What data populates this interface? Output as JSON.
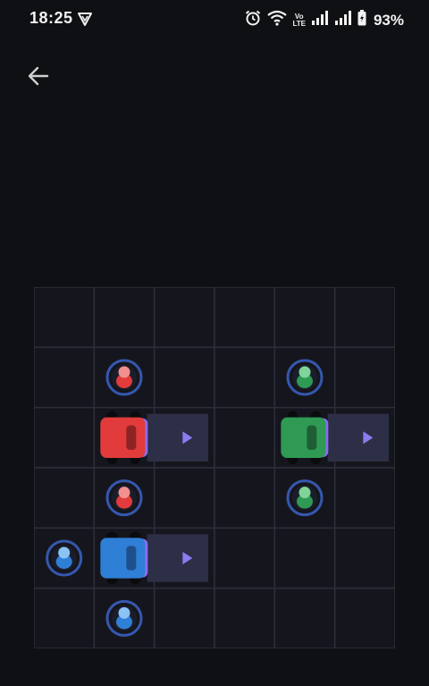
{
  "status_bar": {
    "time": "18:25",
    "battery_percent": "93%",
    "volte_label_top": "Vo",
    "volte_label_bottom": "LTE",
    "icons": [
      "shield-v-icon",
      "alarm-icon",
      "wifi-icon",
      "volte-icon",
      "signal-1-icon",
      "signal-2-icon",
      "battery-icon"
    ]
  },
  "nav": {
    "back_icon": "arrow-left-icon"
  },
  "colors": {
    "background": "#0f1013",
    "board": "#15161d",
    "grid_line": "#2c2e3b",
    "red": "#e23b3b",
    "green": "#2f9a54",
    "blue": "#2f7fd6",
    "lane": "#2c2f45",
    "arrow": "#8b7cf0",
    "ring": "#3b63c9"
  },
  "board": {
    "rows": 6,
    "cols": 6,
    "cars": [
      {
        "color": "red",
        "row": 2,
        "col": 1,
        "length": 2,
        "direction": "right"
      },
      {
        "color": "green",
        "row": 2,
        "col": 4,
        "length": 2,
        "direction": "right"
      },
      {
        "color": "blue",
        "row": 4,
        "col": 1,
        "length": 2,
        "direction": "right"
      }
    ],
    "passengers": [
      {
        "color": "red",
        "row": 1,
        "col": 1
      },
      {
        "color": "green",
        "row": 1,
        "col": 4
      },
      {
        "color": "red",
        "row": 3,
        "col": 1
      },
      {
        "color": "green",
        "row": 3,
        "col": 4
      },
      {
        "color": "blue",
        "row": 4,
        "col": 0
      },
      {
        "color": "blue",
        "row": 5,
        "col": 1
      }
    ]
  }
}
